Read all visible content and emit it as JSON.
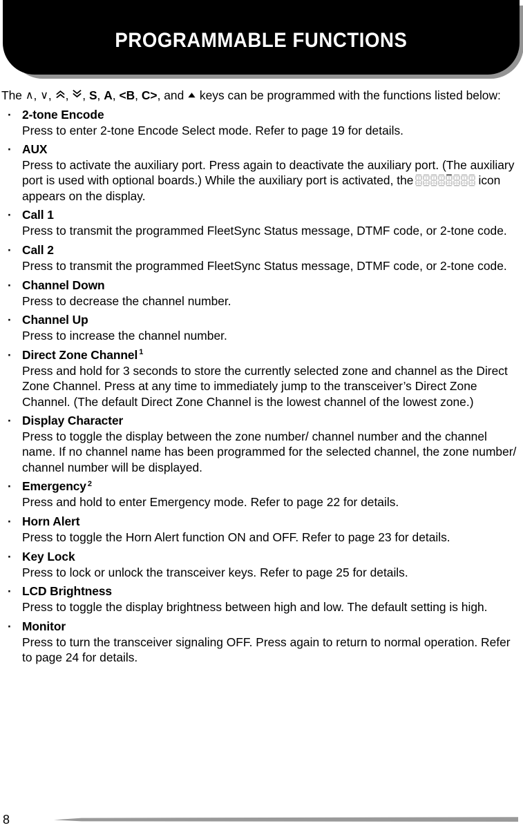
{
  "page": {
    "title": "PROGRAMMABLE FUNCTIONS",
    "number": "8"
  },
  "intro": {
    "prefix": "The ",
    "keys": [
      {
        "glyph": "∧",
        "name": "chevron-up"
      },
      {
        "glyph": "∨",
        "name": "chevron-down"
      },
      {
        "glyph": "«",
        "name": "double-chevron-up"
      },
      {
        "glyph": "»",
        "name": "double-chevron-down"
      },
      {
        "glyph": "S",
        "name": "key-s"
      },
      {
        "glyph": "A",
        "name": "key-a"
      },
      {
        "glyph": "<B",
        "name": "key-b-left"
      },
      {
        "glyph": "C>",
        "name": "key-c-right"
      },
      {
        "glyph": "▲",
        "name": "triangle-up"
      }
    ],
    "separator_and": ", and ",
    "suffix": " keys can be programmed with the functions listed below:"
  },
  "bullet_char": "·",
  "functions": [
    {
      "term": "2-tone Encode",
      "superscript": "",
      "description": "Press to enter 2-tone Encode Select mode.  Refer to page 19 for details."
    },
    {
      "term": "AUX",
      "superscript": "",
      "description_part1": "Press to activate the auxiliary port.  Press again to deactivate the auxiliary port.  (The auxiliary port is used with optional boards.)  While the auxiliary port is activated, the",
      "icon": "segmented-display-icon",
      "description_part2": "icon appears on the display."
    },
    {
      "term": "Call 1",
      "superscript": "",
      "description": "Press to transmit the programmed FleetSync Status message, DTMF code, or 2-tone code."
    },
    {
      "term": "Call 2",
      "superscript": "",
      "description": "Press to transmit the programmed FleetSync Status message, DTMF code, or 2-tone code."
    },
    {
      "term": "Channel Down",
      "superscript": "",
      "description": "Press to decrease the channel number."
    },
    {
      "term": "Channel Up",
      "superscript": "",
      "description": "Press to increase the channel number."
    },
    {
      "term": "Direct Zone Channel",
      "superscript": "1",
      "description": "Press and hold for 3 seconds to store the currently selected zone and channel as the Direct Zone Channel.  Press at any time to immediately jump to the transceiver’s Direct Zone Channel.  (The default Direct Zone Channel is the lowest channel of the lowest zone.)"
    },
    {
      "term": "Display Character",
      "superscript": "",
      "description": "Press to toggle the display between the zone number/ channel number and the channel name.  If no channel name has been programmed for the selected channel, the zone number/ channel number will be displayed."
    },
    {
      "term": "Emergency",
      "superscript": "2",
      "description": "Press and hold to enter Emergency mode.  Refer to page 22 for details."
    },
    {
      "term": "Horn Alert",
      "superscript": "",
      "description": "Press to toggle the Horn Alert function ON and OFF.  Refer to page 23 for details."
    },
    {
      "term": "Key Lock",
      "superscript": "",
      "description": "Press to lock or unlock the transceiver keys.  Refer to page 25 for details."
    },
    {
      "term": "LCD Brightness",
      "superscript": "",
      "description": "Press to toggle the display brightness between high and low.  The default setting is high."
    },
    {
      "term": "Monitor",
      "superscript": "",
      "description": "Press to turn the transceiver signaling OFF.  Press again to return to normal operation.  Refer to page 24 for details."
    }
  ],
  "colors": {
    "banner_background": "#000000",
    "banner_text": "#ffffff",
    "banner_shadow": "#949494",
    "body_text": "#000000",
    "footer_rule": "#9a9a9a",
    "segment_icon": "#b5b5b5"
  }
}
